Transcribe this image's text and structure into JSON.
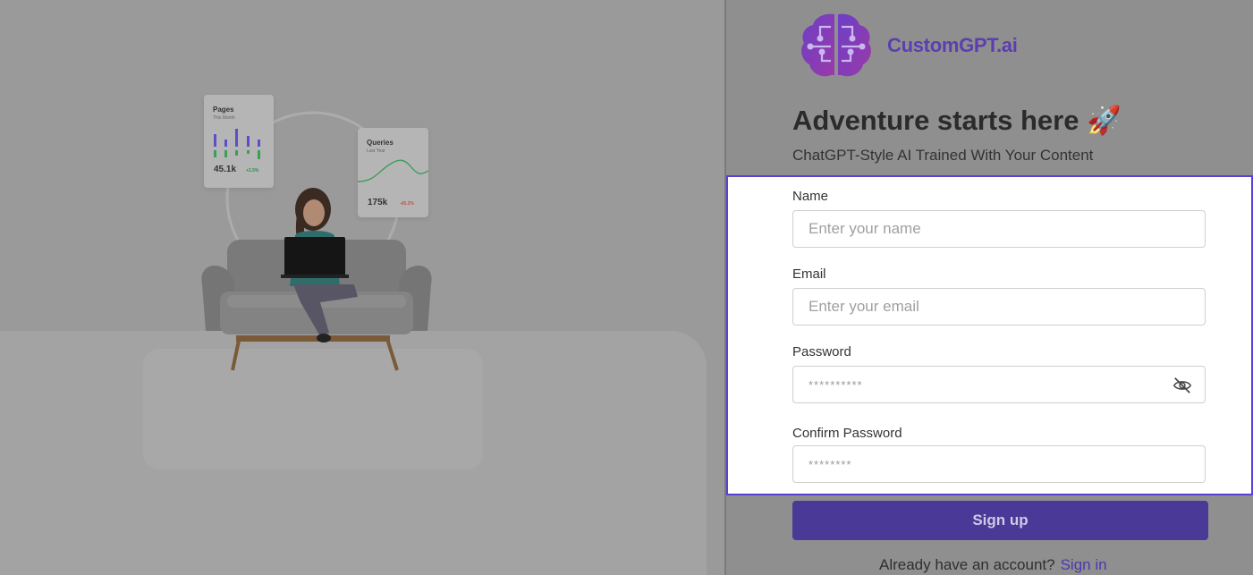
{
  "illustration": {
    "pages_card": {
      "title": "Pages",
      "subtitle": "This Month",
      "value": "45.1k",
      "delta": "+2.5%"
    },
    "queries_card": {
      "title": "Queries",
      "subtitle": "Last Year",
      "value": "175k",
      "delta": "-45.2%"
    }
  },
  "brand": {
    "name": "CustomGPT.ai"
  },
  "header": {
    "headline": "Adventure starts here 🚀",
    "tagline": "ChatGPT-Style AI Trained With Your Content"
  },
  "form": {
    "name": {
      "label": "Name",
      "placeholder": "Enter your name",
      "value": ""
    },
    "email": {
      "label": "Email",
      "placeholder": "Enter your email",
      "value": ""
    },
    "password": {
      "label": "Password",
      "placeholder": "**********",
      "value": ""
    },
    "confirm_password": {
      "label": "Confirm Password",
      "placeholder": "********",
      "value": ""
    },
    "submit_label": "Sign up"
  },
  "footer": {
    "prompt": "Already have an account?",
    "link_label": "Sign in"
  },
  "colors": {
    "accent": "#4a3996",
    "highlight": "#5b3fd6",
    "link": "#4a3ab0"
  }
}
